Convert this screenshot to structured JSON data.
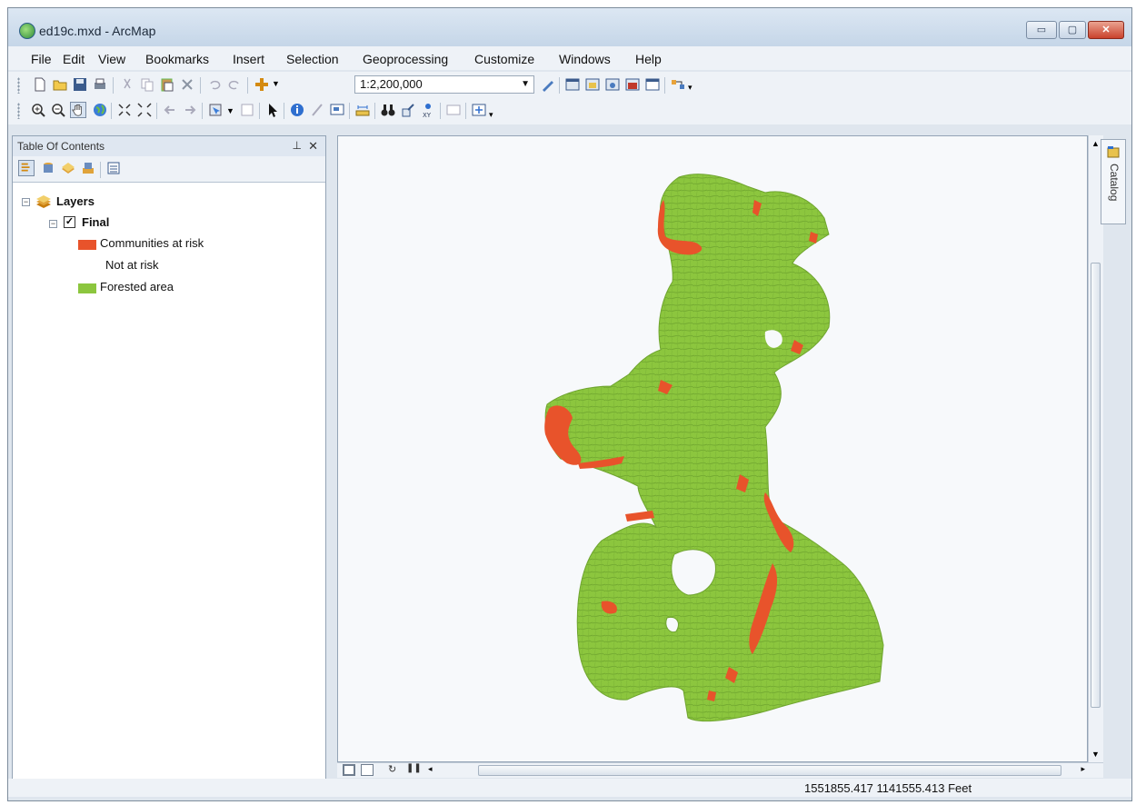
{
  "window": {
    "title": "ed19c.mxd - ArcMap",
    "controls": {
      "minimize": "▭",
      "maximize": "▢",
      "close": "✕"
    }
  },
  "menu": [
    "File",
    "Edit",
    "View",
    "Bookmarks",
    "Insert",
    "Selection",
    "Geoprocessing",
    "Customize",
    "Windows",
    "Help"
  ],
  "standard_toolbar": {
    "scale_value": "1:2,200,000"
  },
  "toc": {
    "title": "Table Of Contents",
    "pin": "⊥",
    "close": "✕",
    "tree": {
      "root": "Layers",
      "layer": "Final",
      "legend": [
        {
          "label": "Communities at risk",
          "color": "#e8532b"
        },
        {
          "label": "Not at risk",
          "color": ""
        },
        {
          "label": "Forested area",
          "color": "#8cc63e"
        }
      ]
    }
  },
  "map": {
    "fill_color": "#8cc63e",
    "edge_color": "#6fa52f",
    "risk_color": "#e8532b"
  },
  "catalog_tab": {
    "label": "Catalog"
  },
  "status": {
    "coordinates": "1551855.417  1141555.413 Feet"
  }
}
